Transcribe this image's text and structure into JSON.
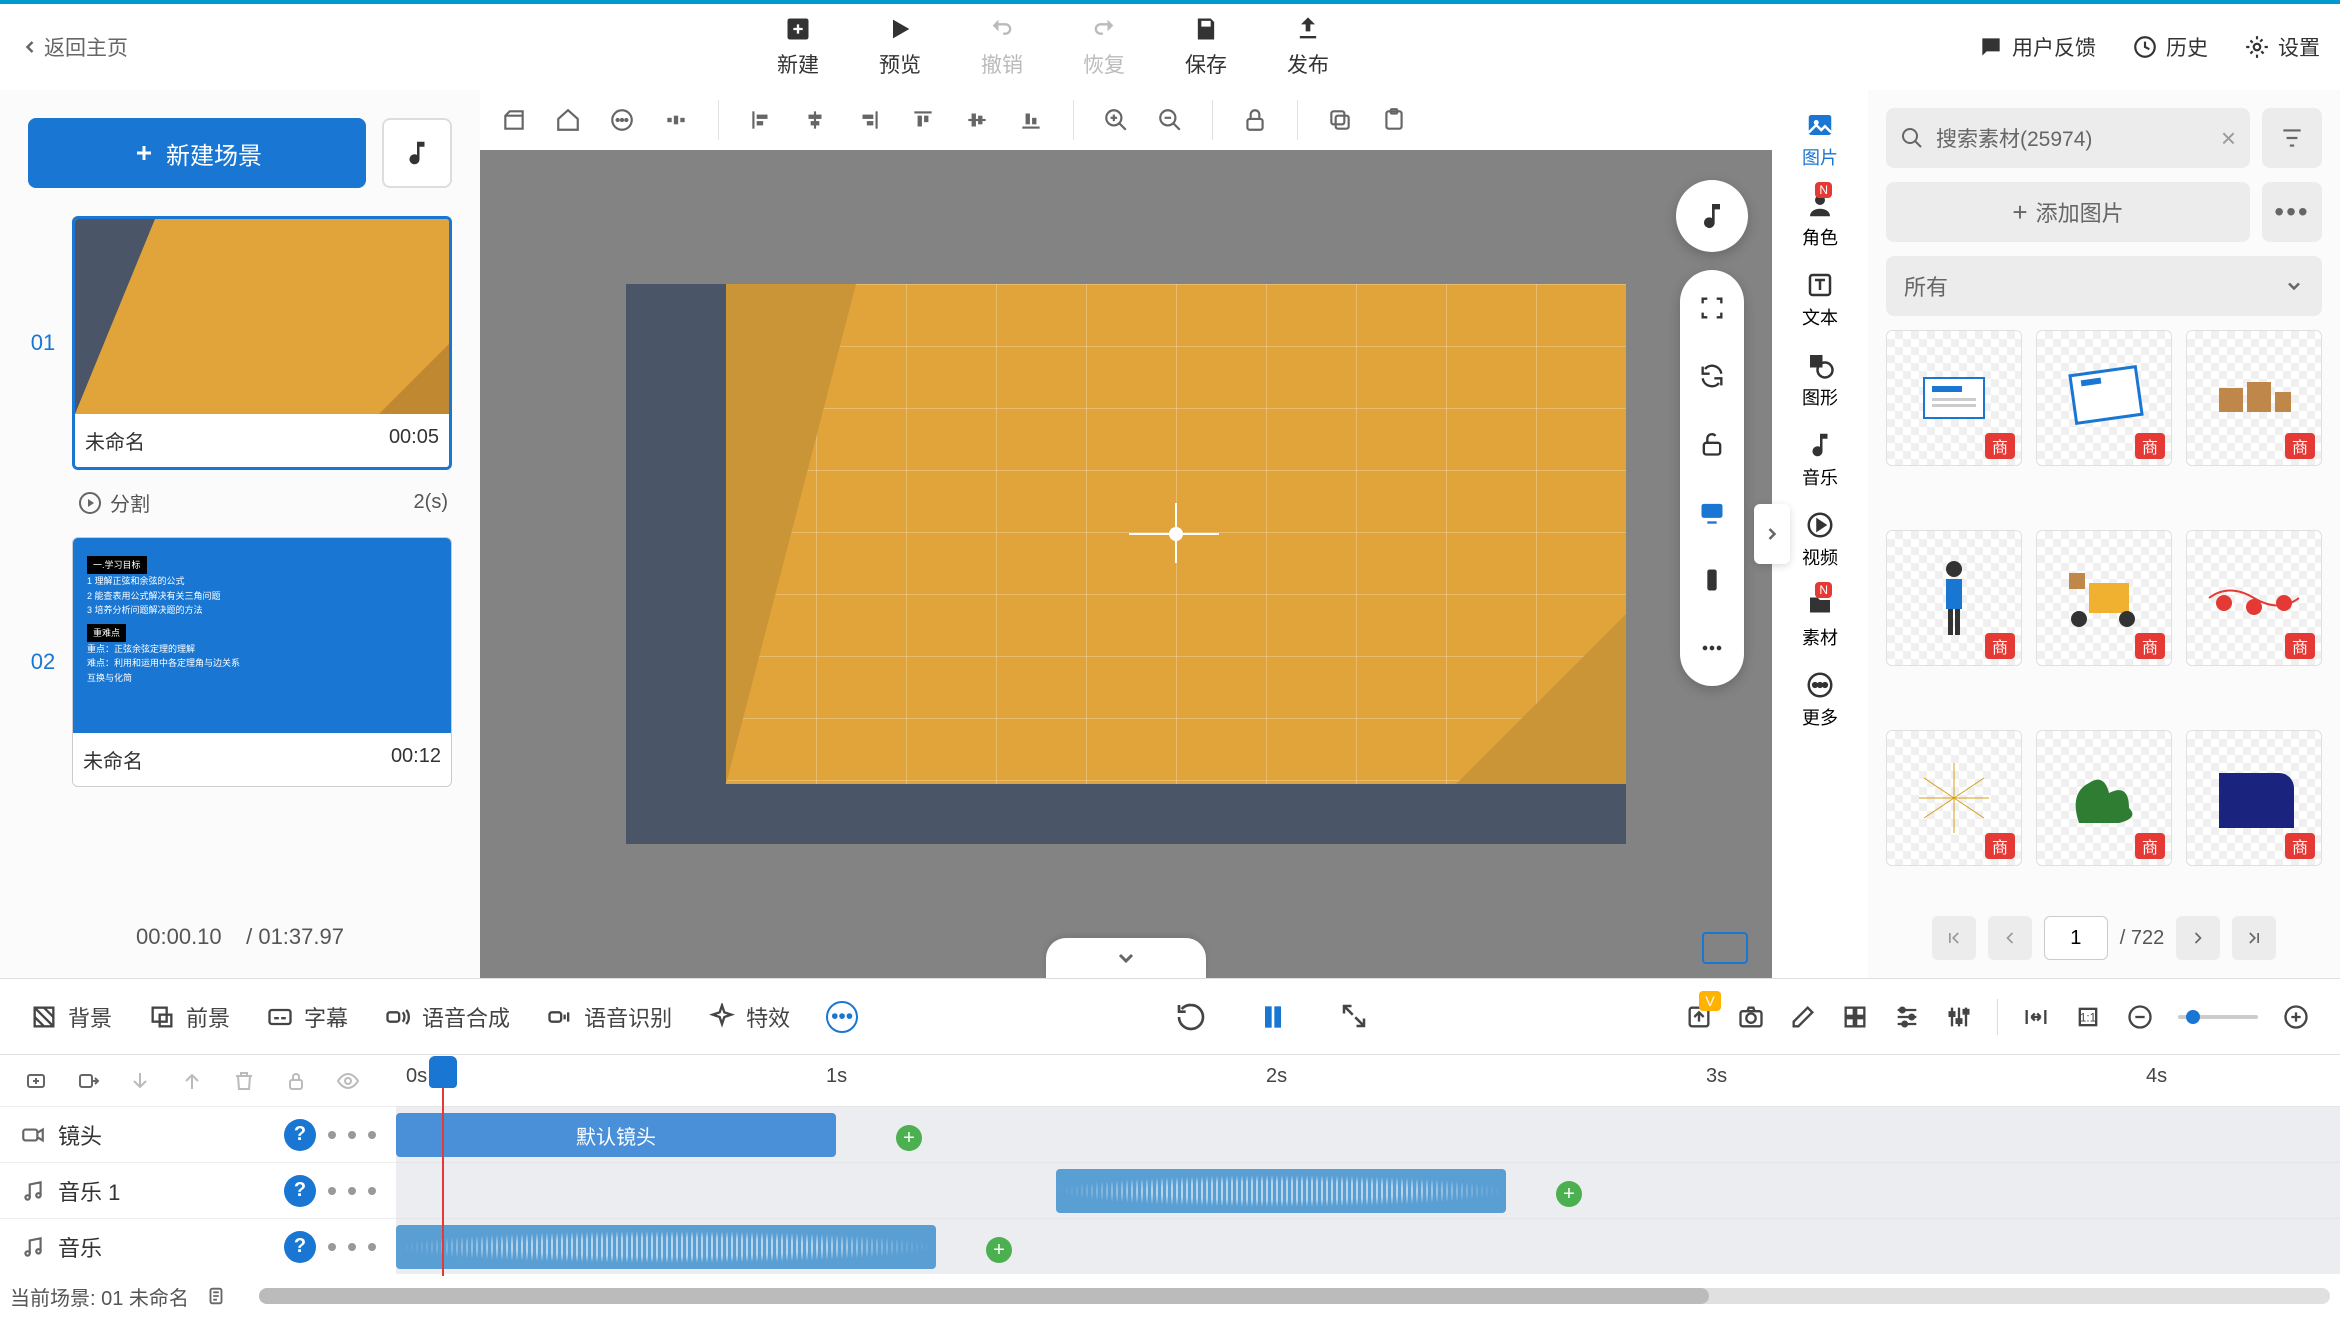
{
  "topnav": {
    "back": "返回主页",
    "items": {
      "new": "新建",
      "preview": "预览",
      "undo": "撤销",
      "redo": "恢复",
      "save": "保存",
      "publish": "发布"
    },
    "right": {
      "feedback": "用户反馈",
      "history": "历史",
      "settings": "设置"
    }
  },
  "leftPanel": {
    "newScene": "新建场景",
    "scenes": [
      {
        "num": "01",
        "name": "未命名",
        "duration": "00:05"
      },
      {
        "num": "02",
        "name": "未命名",
        "duration": "00:12"
      }
    ],
    "splitLabel": "分割",
    "splitValue": "2(s)",
    "timeCurrent": "00:00.10",
    "timeTotal": "/ 01:37.97"
  },
  "rail": {
    "image": "图片",
    "character": "角色",
    "text": "文本",
    "shape": "图形",
    "music": "音乐",
    "video": "视频",
    "material": "素材",
    "more": "更多"
  },
  "rightPanel": {
    "searchPlaceholder": "搜索素材(25974)",
    "addImage": "添加图片",
    "filterAll": "所有",
    "assetTag": "商",
    "page": "1",
    "totalPages": "/ 722"
  },
  "tools": {
    "background": "背景",
    "foreground": "前景",
    "subtitle": "字幕",
    "tts": "语音合成",
    "asr": "语音识别",
    "fx": "特效"
  },
  "timeline": {
    "ticks": [
      "0s",
      "1s",
      "2s",
      "3s",
      "4s"
    ],
    "tracks": {
      "camera": "镜头",
      "music1": "音乐 1",
      "music2": "音乐"
    },
    "defaultCamera": "默认镜头"
  },
  "status": {
    "label": "当前场景: 01   未命名"
  }
}
